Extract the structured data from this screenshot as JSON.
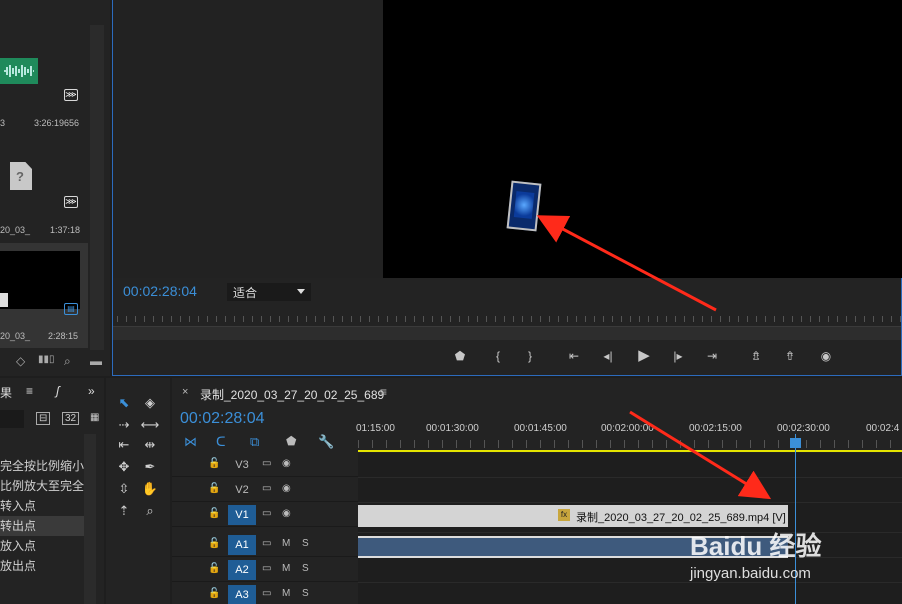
{
  "project_panel": {
    "items": [
      {
        "name": "",
        "meta_left": "3",
        "duration": "3:26:19656"
      },
      {
        "name": "",
        "meta_left": "20_03_",
        "duration": "1:37:18",
        "icon_text": "?"
      },
      {
        "name": "",
        "meta_left": "20_03_",
        "duration": "2:28:15"
      }
    ]
  },
  "program_monitor": {
    "timecode": "00:02:28:04",
    "fit": "适合"
  },
  "effects_panel": {
    "tab_label": "果",
    "tab2_label": "ʃ",
    "items": [
      "完全按比例缩小",
      "比例放大至完全",
      "转入点",
      "转出点",
      "放入点",
      "放出点"
    ]
  },
  "timeline": {
    "title": "录制_2020_03_27_20_02_25_689",
    "timecode": "00:02:28:04",
    "ruler_ticks": [
      "01:15:00",
      "00:01:30:00",
      "00:01:45:00",
      "00:02:00:00",
      "00:02:15:00",
      "00:02:30:00",
      "00:02:4"
    ],
    "tracks": [
      {
        "name": "V3",
        "active": false
      },
      {
        "name": "V2",
        "active": false
      },
      {
        "name": "V1",
        "active": true
      },
      {
        "name": "A1",
        "active": true,
        "audio": true
      },
      {
        "name": "A2",
        "active": true,
        "audio": true
      },
      {
        "name": "A3",
        "active": true,
        "audio": true
      }
    ],
    "v1_clip_label": "录制_2020_03_27_20_02_25_689.mp4 [V]",
    "fx_badge": "fx",
    "audio_m": "M",
    "audio_s": "S"
  },
  "watermark": {
    "text": "Baidu 经验",
    "url": "jingyan.baidu.com"
  },
  "colors": {
    "accent": "#3b8fd8",
    "audio_clip": "#3e5a7d",
    "annotation": "#ff2a1a"
  }
}
